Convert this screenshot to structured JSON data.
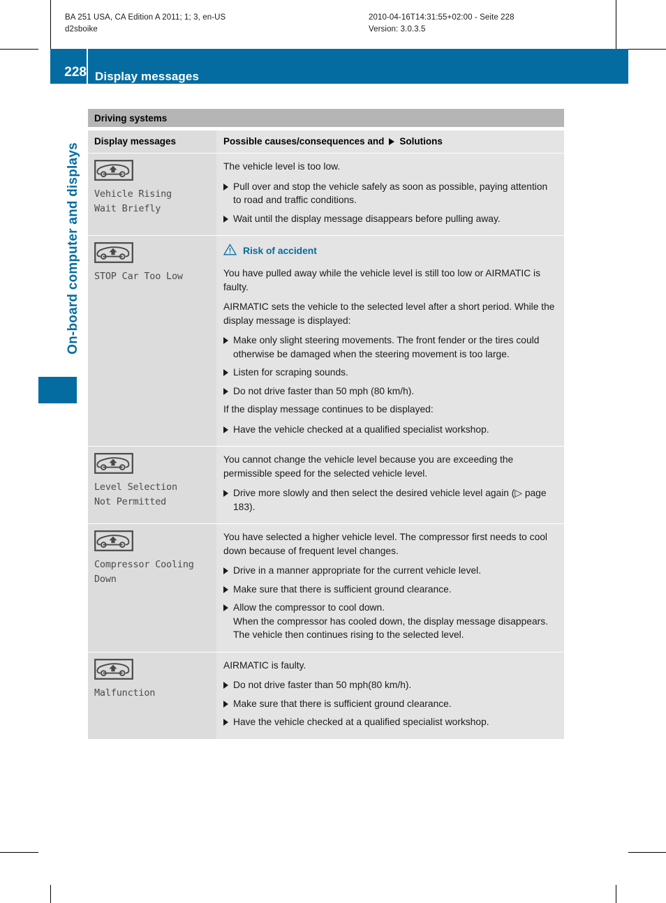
{
  "print_meta": {
    "left_line1": "BA 251 USA, CA Edition A 2011; 1; 3, en-US",
    "left_line2": "d2sboike",
    "right_line1": "2010-04-16T14:31:55+02:00 - Seite 228",
    "right_line2": "Version: 3.0.3.5"
  },
  "header": {
    "page_number": "228",
    "title": "Display messages",
    "bar_color": "#046ca1"
  },
  "chapter": {
    "label": "On-board computer and displays",
    "color": "#046ca1"
  },
  "table": {
    "section_title": "Driving systems",
    "columns": {
      "left": "Display messages",
      "right_before": "Possible causes/consequences and",
      "right_after": "Solutions"
    },
    "rows": [
      {
        "icon": "vehicle-level-raise-icon",
        "message": "Vehicle Rising\nWait Briefly",
        "content": [
          {
            "type": "para",
            "text": "The vehicle level is too low."
          },
          {
            "type": "bullet",
            "text": "Pull over and stop the vehicle safely as soon as possible, paying attention to road and traffic conditions."
          },
          {
            "type": "bullet",
            "text": "Wait until the display message disappears before pulling away."
          }
        ]
      },
      {
        "icon": "vehicle-level-raise-icon",
        "message": "STOP Car Too Low",
        "content": [
          {
            "type": "warning",
            "text": "Risk of accident"
          },
          {
            "type": "para",
            "text": "You have pulled away while the vehicle level is still too low or AIRMATIC is faulty."
          },
          {
            "type": "para",
            "text": "AIRMATIC sets the vehicle to the selected level after a short period. While the display message is displayed:"
          },
          {
            "type": "bullet",
            "text": "Make only slight steering movements. The front fender or the tires could otherwise be damaged when the steering movement is too large."
          },
          {
            "type": "bullet",
            "text": "Listen for scraping sounds."
          },
          {
            "type": "bullet",
            "text": "Do not drive faster than 50 mph (80 km/h)."
          },
          {
            "type": "para",
            "text": "If the display message continues to be displayed:"
          },
          {
            "type": "bullet",
            "text": "Have the vehicle checked at a qualified specialist workshop."
          }
        ]
      },
      {
        "icon": "vehicle-level-raise-icon",
        "message": "Level Selection\nNot Permitted",
        "content": [
          {
            "type": "para",
            "text": "You cannot change the vehicle level because you are exceeding the permissible speed for the selected vehicle level."
          },
          {
            "type": "bullet",
            "text": "Drive more slowly and then select the desired vehicle level again (▷ page 183)."
          }
        ]
      },
      {
        "icon": "vehicle-level-raise-icon",
        "message": "Compressor Cooling\nDown",
        "content": [
          {
            "type": "para",
            "text": "You have selected a higher vehicle level. The compressor first needs to cool down because of frequent level changes."
          },
          {
            "type": "bullet",
            "text": "Drive in a manner appropriate for the current vehicle level."
          },
          {
            "type": "bullet",
            "text": "Make sure that there is sufficient ground clearance."
          },
          {
            "type": "bullet",
            "text": "Allow the compressor to cool down.",
            "sub": "When the compressor has cooled down, the display message disappears. The vehicle then continues rising to the selected level."
          }
        ]
      },
      {
        "icon": "vehicle-level-raise-icon",
        "message": "Malfunction",
        "content": [
          {
            "type": "para",
            "text": "AIRMATIC is faulty."
          },
          {
            "type": "bullet",
            "text": "Do not drive faster than 50 mph(80 km/h)."
          },
          {
            "type": "bullet",
            "text": "Make sure that there is sufficient ground clearance."
          },
          {
            "type": "bullet",
            "text": "Have the vehicle checked at a qualified specialist workshop."
          }
        ]
      }
    ]
  }
}
